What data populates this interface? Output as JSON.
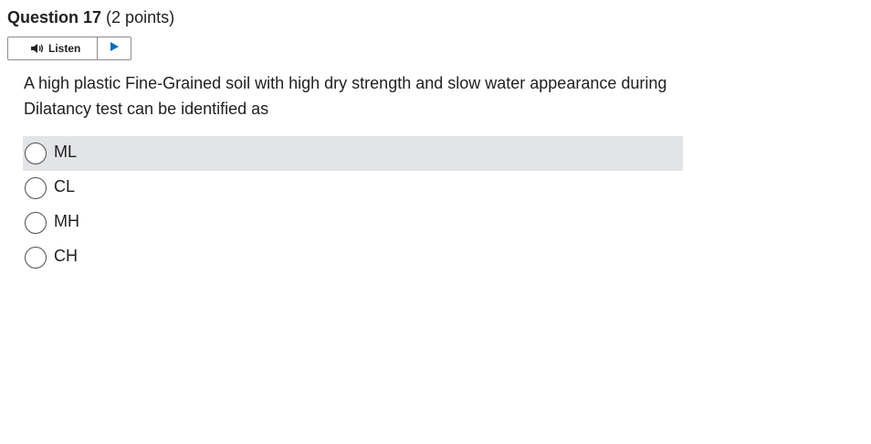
{
  "question": {
    "title": "Question 17",
    "points": "(2 points)",
    "text": "A high plastic Fine-Grained soil with high dry strength and slow water appearance during Dilatancy test can be identified as"
  },
  "listen": {
    "label": "Listen",
    "speaker_icon": "speaker-icon",
    "play_icon": "play-icon",
    "accent_color": "#006fbf"
  },
  "options": [
    {
      "label": "ML",
      "highlighted": true
    },
    {
      "label": "CL",
      "highlighted": false
    },
    {
      "label": "MH",
      "highlighted": false
    },
    {
      "label": "CH",
      "highlighted": false
    }
  ],
  "colors": {
    "text": "#202122",
    "highlight_bg": "#e3e4e6",
    "border": "#8a8c8f"
  }
}
